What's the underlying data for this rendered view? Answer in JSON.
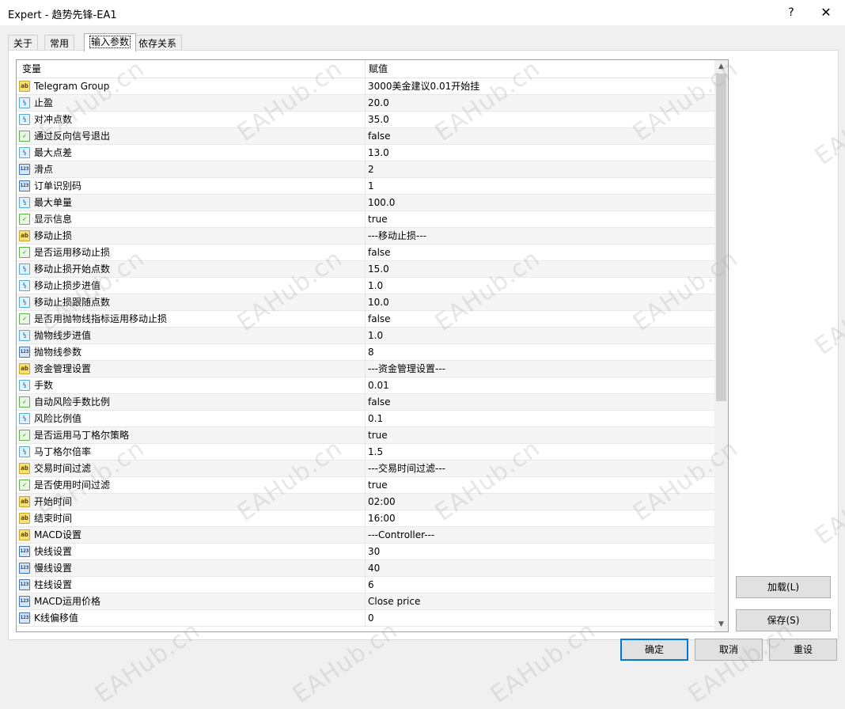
{
  "window": {
    "title": "Expert - 趋势先锋-EA1",
    "help_label": "?",
    "close_label": "✕"
  },
  "tabs": [
    {
      "label": "关于"
    },
    {
      "label": "常用"
    },
    {
      "label": "输入参数"
    },
    {
      "label": "依存关系"
    }
  ],
  "grid": {
    "col_variable": "变量",
    "col_value": "赋值",
    "rows": [
      {
        "icon": "ab",
        "name": "Telegram Group",
        "value": "3000美金建议0.01开始挂"
      },
      {
        "icon": "dbl",
        "name": "止盈",
        "value": "20.0"
      },
      {
        "icon": "dbl",
        "name": "对冲点数",
        "value": "35.0"
      },
      {
        "icon": "bool",
        "name": "通过反向信号退出",
        "value": "false"
      },
      {
        "icon": "dbl",
        "name": "最大点差",
        "value": "13.0"
      },
      {
        "icon": "int",
        "name": "滑点",
        "value": "2"
      },
      {
        "icon": "int",
        "name": "订单识别码",
        "value": "1"
      },
      {
        "icon": "dbl",
        "name": "最大单量",
        "value": "100.0"
      },
      {
        "icon": "bool",
        "name": "显示信息",
        "value": "true"
      },
      {
        "icon": "ab",
        "name": "移动止损",
        "value": "---移动止损---"
      },
      {
        "icon": "bool",
        "name": "是否运用移动止损",
        "value": "false"
      },
      {
        "icon": "dbl",
        "name": "移动止损开始点数",
        "value": "15.0"
      },
      {
        "icon": "dbl",
        "name": "移动止损步进值",
        "value": "1.0"
      },
      {
        "icon": "dbl",
        "name": "移动止损跟随点数",
        "value": "10.0"
      },
      {
        "icon": "bool",
        "name": "是否用抛物线指标运用移动止损",
        "value": "false"
      },
      {
        "icon": "dbl",
        "name": "抛物线步进值",
        "value": "1.0"
      },
      {
        "icon": "int",
        "name": "抛物线参数",
        "value": "8"
      },
      {
        "icon": "ab",
        "name": "资金管理设置",
        "value": "---资金管理设置---"
      },
      {
        "icon": "dbl",
        "name": "手数",
        "value": "0.01"
      },
      {
        "icon": "bool",
        "name": "自动风险手数比例",
        "value": "false"
      },
      {
        "icon": "dbl",
        "name": "风险比例值",
        "value": "0.1"
      },
      {
        "icon": "bool",
        "name": "是否运用马丁格尔策略",
        "value": "true"
      },
      {
        "icon": "dbl",
        "name": "马丁格尔倍率",
        "value": "1.5"
      },
      {
        "icon": "ab",
        "name": "交易时间过滤",
        "value": "---交易时间过滤---"
      },
      {
        "icon": "bool",
        "name": "是否使用时间过滤",
        "value": "true"
      },
      {
        "icon": "ab",
        "name": "开始时间",
        "value": "02:00"
      },
      {
        "icon": "ab",
        "name": "结束时间",
        "value": "16:00"
      },
      {
        "icon": "ab",
        "name": "MACD设置",
        "value": "---Controller---"
      },
      {
        "icon": "int",
        "name": "快线设置",
        "value": "30"
      },
      {
        "icon": "int",
        "name": "慢线设置",
        "value": "40"
      },
      {
        "icon": "int",
        "name": "柱线设置",
        "value": "6"
      },
      {
        "icon": "int",
        "name": "MACD运用价格",
        "value": "Close price"
      },
      {
        "icon": "int",
        "name": "K线偏移值",
        "value": "0"
      }
    ]
  },
  "icons": {
    "ab": {
      "name": "string-type-icon",
      "glyph": "ab"
    },
    "dbl": {
      "name": "double-type-icon",
      "glyph": "½"
    },
    "bool": {
      "name": "bool-type-icon",
      "glyph": "✓"
    },
    "int": {
      "name": "integer-type-icon",
      "glyph": "123"
    }
  },
  "buttons": {
    "load": "加载(L)",
    "save": "保存(S)",
    "ok": "确定",
    "cancel": "取消",
    "reset": "重设"
  },
  "watermark": "EAHub.cn"
}
